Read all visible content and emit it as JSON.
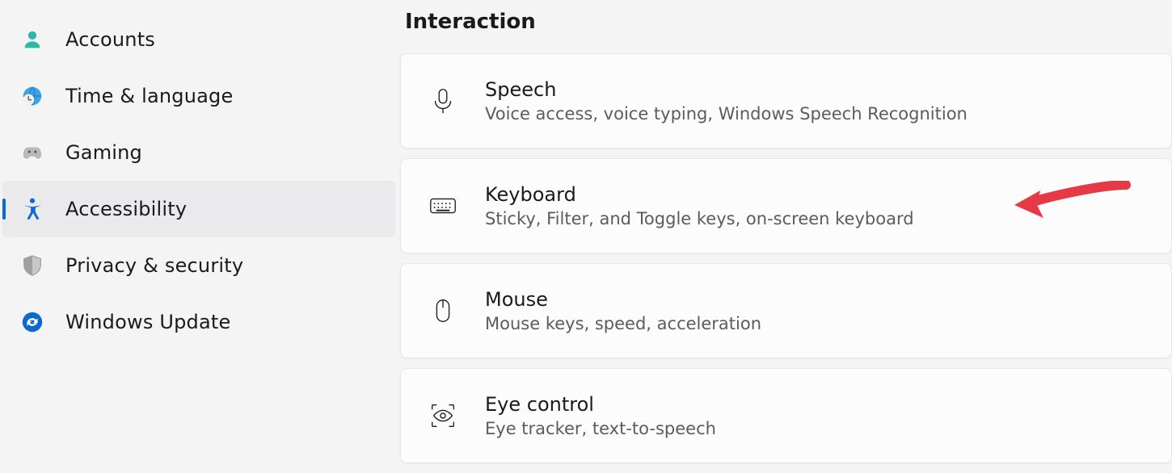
{
  "nav": {
    "items": [
      {
        "id": "accounts",
        "label": "Accounts"
      },
      {
        "id": "time-language",
        "label": "Time & language"
      },
      {
        "id": "gaming",
        "label": "Gaming"
      },
      {
        "id": "accessibility",
        "label": "Accessibility"
      },
      {
        "id": "privacy",
        "label": "Privacy & security"
      },
      {
        "id": "windows-update",
        "label": "Windows Update"
      }
    ],
    "active": "accessibility"
  },
  "main": {
    "section_title": "Interaction",
    "cards": [
      {
        "id": "speech",
        "title": "Speech",
        "sub": "Voice access, voice typing, Windows Speech Recognition"
      },
      {
        "id": "keyboard",
        "title": "Keyboard",
        "sub": "Sticky, Filter, and Toggle keys, on-screen keyboard"
      },
      {
        "id": "mouse",
        "title": "Mouse",
        "sub": "Mouse keys, speed, acceleration"
      },
      {
        "id": "eye-control",
        "title": "Eye control",
        "sub": "Eye tracker, text-to-speech"
      }
    ]
  },
  "annotation": {
    "target_card": "keyboard",
    "arrow_color": "#e53946"
  }
}
